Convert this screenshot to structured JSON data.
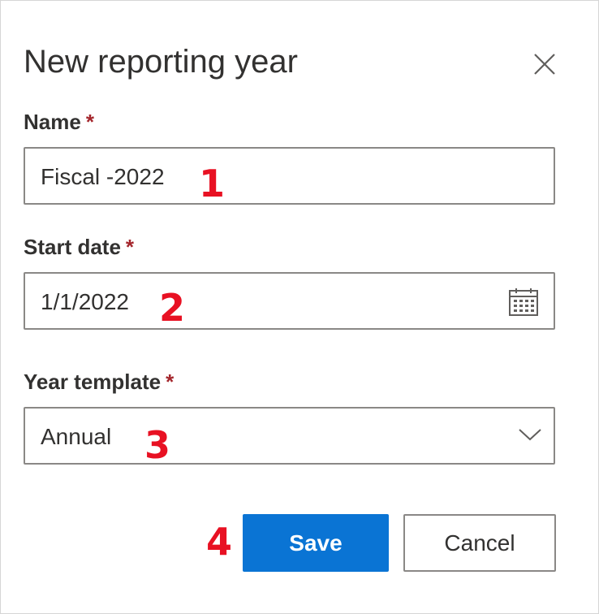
{
  "dialog": {
    "title": "New reporting year",
    "close_icon": "close-icon"
  },
  "fields": {
    "name": {
      "label": "Name",
      "required_marker": "*",
      "value": "Fiscal -2022"
    },
    "start_date": {
      "label": "Start date",
      "required_marker": "*",
      "value": "1/1/2022",
      "icon": "calendar-icon"
    },
    "year_template": {
      "label": "Year template",
      "required_marker": "*",
      "value": "Annual",
      "icon": "chevron-down-icon"
    }
  },
  "annotations": {
    "step1": "1",
    "step2": "2",
    "step3": "3",
    "step4": "4",
    "color": "#e81123"
  },
  "actions": {
    "save_label": "Save",
    "cancel_label": "Cancel",
    "primary_color": "#0a74d4"
  }
}
